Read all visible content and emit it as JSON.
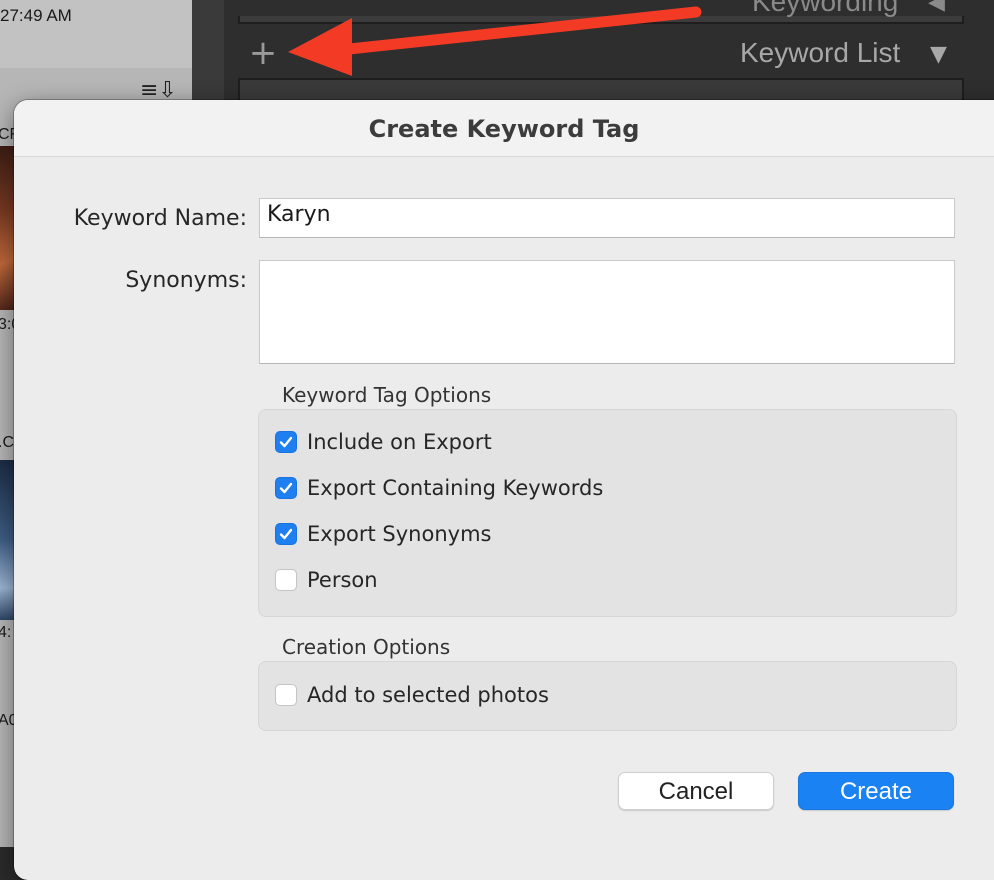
{
  "background": {
    "time_label": "27:49 AM",
    "cell_labels": [
      "CF",
      "3:0",
      ".C",
      "4:",
      "A0"
    ],
    "panel_keywording": "Keywording",
    "keyword_list_title": "Keyword List",
    "plus_icon": "plus-icon",
    "annotation_color": "#f23a24"
  },
  "dialog": {
    "title": "Create Keyword Tag",
    "keyword_name_label": "Keyword Name:",
    "keyword_name_value": "Karyn",
    "synonyms_label": "Synonyms:",
    "synonyms_value": "",
    "keyword_tag_options": {
      "title": "Keyword Tag Options",
      "options": [
        {
          "label": "Include on Export",
          "checked": true
        },
        {
          "label": "Export Containing Keywords",
          "checked": true
        },
        {
          "label": "Export Synonyms",
          "checked": true
        },
        {
          "label": "Person",
          "checked": false
        }
      ]
    },
    "creation_options": {
      "title": "Creation Options",
      "options": [
        {
          "label": "Add to selected photos",
          "checked": false
        }
      ]
    },
    "cancel_label": "Cancel",
    "create_label": "Create"
  },
  "colors": {
    "accent": "#1a82f2",
    "checkbox_checked": "#1f7ff0",
    "dialog_bg": "#ececec"
  }
}
